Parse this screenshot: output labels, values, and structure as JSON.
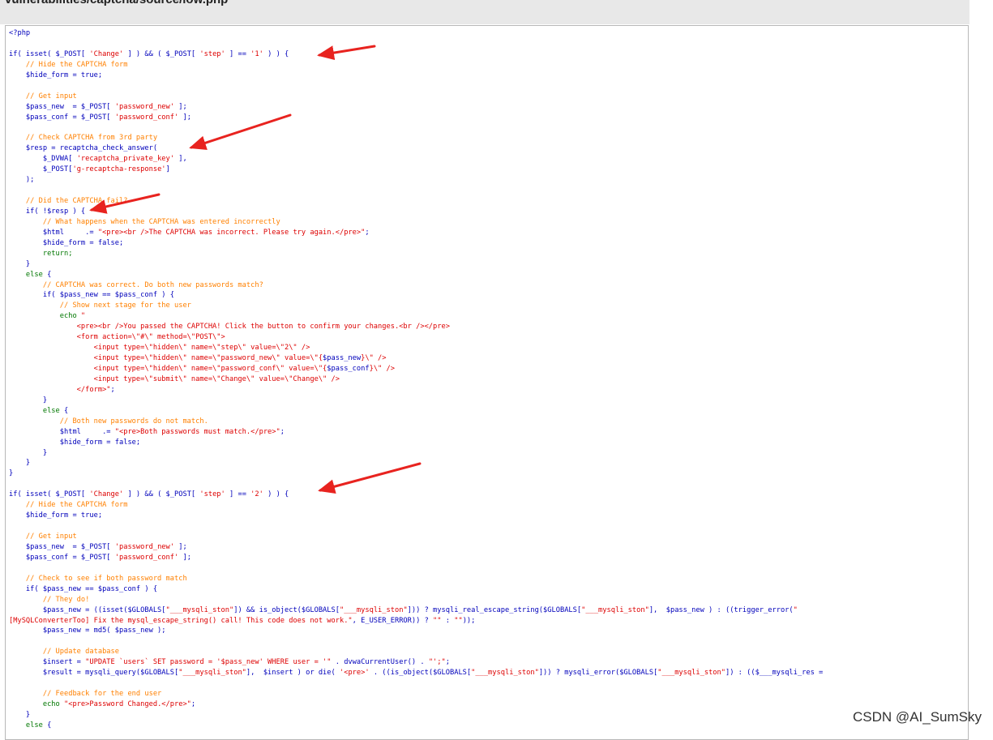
{
  "page_title": "vulnerabilities/captcha/source/low.php",
  "watermark": "CSDN @AI_SumSky",
  "colors": {
    "default": "#0000bb",
    "comment": "#ff8000",
    "string": "#dd0000",
    "keyword": "#007700",
    "arrow": "#e8231f"
  },
  "code_lines": [
    [
      [
        "d",
        "<?php"
      ]
    ],
    [],
    [
      [
        "d",
        "if( isset( $_POST[ "
      ],
      [
        "s",
        "'Change'"
      ],
      [
        "d",
        " ] ) && ( $_POST[ "
      ],
      [
        "s",
        "'step'"
      ],
      [
        "d",
        " ] == "
      ],
      [
        "s",
        "'1'"
      ],
      [
        "d",
        " ) ) {"
      ]
    ],
    [
      [
        "c",
        "    // Hide the CAPTCHA form"
      ]
    ],
    [
      [
        "d",
        "    $hide_form = true;"
      ]
    ],
    [],
    [
      [
        "c",
        "    // Get input"
      ]
    ],
    [
      [
        "d",
        "    $pass_new  = $_POST[ "
      ],
      [
        "s",
        "'password_new'"
      ],
      [
        "d",
        " ];"
      ]
    ],
    [
      [
        "d",
        "    $pass_conf = $_POST[ "
      ],
      [
        "s",
        "'password_conf'"
      ],
      [
        "d",
        " ];"
      ]
    ],
    [],
    [
      [
        "c",
        "    // Check CAPTCHA from 3rd party"
      ]
    ],
    [
      [
        "d",
        "    $resp = recaptcha_check_answer("
      ]
    ],
    [
      [
        "d",
        "        $_DVWA[ "
      ],
      [
        "s",
        "'recaptcha_private_key'"
      ],
      [
        "d",
        " ],"
      ]
    ],
    [
      [
        "d",
        "        $_POST["
      ],
      [
        "s",
        "'g-recaptcha-response'"
      ],
      [
        "d",
        "]"
      ]
    ],
    [
      [
        "d",
        "    );"
      ]
    ],
    [],
    [
      [
        "c",
        "    // Did the CAPTCHA fail?"
      ]
    ],
    [
      [
        "d",
        "    if( !$resp ) {"
      ]
    ],
    [
      [
        "c",
        "        // What happens when the CAPTCHA was entered incorrectly"
      ]
    ],
    [
      [
        "d",
        "        $html     .= "
      ],
      [
        "s",
        "\"<pre><br />The CAPTCHA was incorrect. Please try again.</pre>\""
      ],
      [
        "d",
        ";"
      ]
    ],
    [
      [
        "d",
        "        $hide_form = false;"
      ]
    ],
    [
      [
        "k",
        "        return;"
      ]
    ],
    [
      [
        "d",
        "    }"
      ]
    ],
    [
      [
        "k",
        "    else"
      ],
      [
        "d",
        " {"
      ]
    ],
    [
      [
        "c",
        "        // CAPTCHA was correct. Do both new passwords match?"
      ]
    ],
    [
      [
        "d",
        "        if( $pass_new == $pass_conf ) {"
      ]
    ],
    [
      [
        "c",
        "            // Show next stage for the user"
      ]
    ],
    [
      [
        "k",
        "            echo "
      ],
      [
        "s",
        "\""
      ]
    ],
    [
      [
        "s",
        "                <pre><br />You passed the CAPTCHA! Click the button to confirm your changes.<br /></pre>"
      ]
    ],
    [
      [
        "s",
        "                <form action=\\\"#\\\" method=\\\"POST\\\">"
      ]
    ],
    [
      [
        "s",
        "                    <input type=\\\"hidden\\\" name=\\\"step\\\" value=\\\"2\\\" />"
      ]
    ],
    [
      [
        "s",
        "                    <input type=\\\"hidden\\\" name=\\\"password_new\\\" value=\\\"{"
      ],
      [
        "d",
        "$pass_new"
      ],
      [
        "s",
        "}\\\" />"
      ]
    ],
    [
      [
        "s",
        "                    <input type=\\\"hidden\\\" name=\\\"password_conf\\\" value=\\\"{"
      ],
      [
        "d",
        "$pass_conf"
      ],
      [
        "s",
        "}\\\" />"
      ]
    ],
    [
      [
        "s",
        "                    <input type=\\\"submit\\\" name=\\\"Change\\\" value=\\\"Change\\\" />"
      ]
    ],
    [
      [
        "s",
        "                </form>\""
      ],
      [
        "d",
        ";"
      ]
    ],
    [
      [
        "d",
        "        }"
      ]
    ],
    [
      [
        "k",
        "        else"
      ],
      [
        "d",
        " {"
      ]
    ],
    [
      [
        "c",
        "            // Both new passwords do not match."
      ]
    ],
    [
      [
        "d",
        "            $html     .= "
      ],
      [
        "s",
        "\"<pre>Both passwords must match.</pre>\""
      ],
      [
        "d",
        ";"
      ]
    ],
    [
      [
        "d",
        "            $hide_form = false;"
      ]
    ],
    [
      [
        "d",
        "        }"
      ]
    ],
    [
      [
        "d",
        "    }"
      ]
    ],
    [
      [
        "d",
        "}"
      ]
    ],
    [],
    [
      [
        "d",
        "if( isset( $_POST[ "
      ],
      [
        "s",
        "'Change'"
      ],
      [
        "d",
        " ] ) && ( $_POST[ "
      ],
      [
        "s",
        "'step'"
      ],
      [
        "d",
        " ] == "
      ],
      [
        "s",
        "'2'"
      ],
      [
        "d",
        " ) ) {"
      ]
    ],
    [
      [
        "c",
        "    // Hide the CAPTCHA form"
      ]
    ],
    [
      [
        "d",
        "    $hide_form = true;"
      ]
    ],
    [],
    [
      [
        "c",
        "    // Get input"
      ]
    ],
    [
      [
        "d",
        "    $pass_new  = $_POST[ "
      ],
      [
        "s",
        "'password_new'"
      ],
      [
        "d",
        " ];"
      ]
    ],
    [
      [
        "d",
        "    $pass_conf = $_POST[ "
      ],
      [
        "s",
        "'password_conf'"
      ],
      [
        "d",
        " ];"
      ]
    ],
    [],
    [
      [
        "c",
        "    // Check to see if both password match"
      ]
    ],
    [
      [
        "d",
        "    if( $pass_new == $pass_conf ) {"
      ]
    ],
    [
      [
        "c",
        "        // They do!"
      ]
    ],
    [
      [
        "d",
        "        $pass_new = ((isset($GLOBALS["
      ],
      [
        "s",
        "\"___mysqli_ston\""
      ],
      [
        "d",
        "]) && is_object($GLOBALS["
      ],
      [
        "s",
        "\"___mysqli_ston\""
      ],
      [
        "d",
        "])) ? mysqli_real_escape_string($GLOBALS["
      ],
      [
        "s",
        "\"___mysqli_ston\""
      ],
      [
        "d",
        "],  $pass_new ) : ((trigger_error("
      ],
      [
        "s",
        "\""
      ]
    ],
    [
      [
        "s",
        "[MySQLConverterToo] Fix the mysql_escape_string() call! This code does not work.\""
      ],
      [
        "d",
        ", E_USER_ERROR)) ? "
      ],
      [
        "s",
        "\"\""
      ],
      [
        "d",
        " : "
      ],
      [
        "s",
        "\"\""
      ],
      [
        "d",
        "));"
      ]
    ],
    [
      [
        "d",
        "        $pass_new = md5( $pass_new );"
      ]
    ],
    [],
    [
      [
        "c",
        "        // Update database"
      ]
    ],
    [
      [
        "d",
        "        $insert = "
      ],
      [
        "s",
        "\"UPDATE `users` SET password = '$pass_new' WHERE user = '\""
      ],
      [
        "d",
        " . dvwaCurrentUser() . "
      ],
      [
        "s",
        "\"';\""
      ],
      [
        "d",
        ";"
      ]
    ],
    [
      [
        "d",
        "        $result = mysqli_query($GLOBALS["
      ],
      [
        "s",
        "\"___mysqli_ston\""
      ],
      [
        "d",
        "],  $insert ) or die( "
      ],
      [
        "s",
        "'<pre>'"
      ],
      [
        "d",
        " . ((is_object($GLOBALS["
      ],
      [
        "s",
        "\"___mysqli_ston\""
      ],
      [
        "d",
        "])) ? mysqli_error($GLOBALS["
      ],
      [
        "s",
        "\"___mysqli_ston\""
      ],
      [
        "d",
        "]) : (($___mysqli_res ="
      ]
    ],
    [],
    [
      [
        "c",
        "        // Feedback for the end user"
      ]
    ],
    [
      [
        "k",
        "        echo "
      ],
      [
        "s",
        "\"<pre>Password Changed.</pre>\""
      ],
      [
        "d",
        ";"
      ]
    ],
    [
      [
        "d",
        "    }"
      ]
    ],
    [
      [
        "k",
        "    else"
      ],
      [
        "d",
        " {"
      ]
    ]
  ]
}
